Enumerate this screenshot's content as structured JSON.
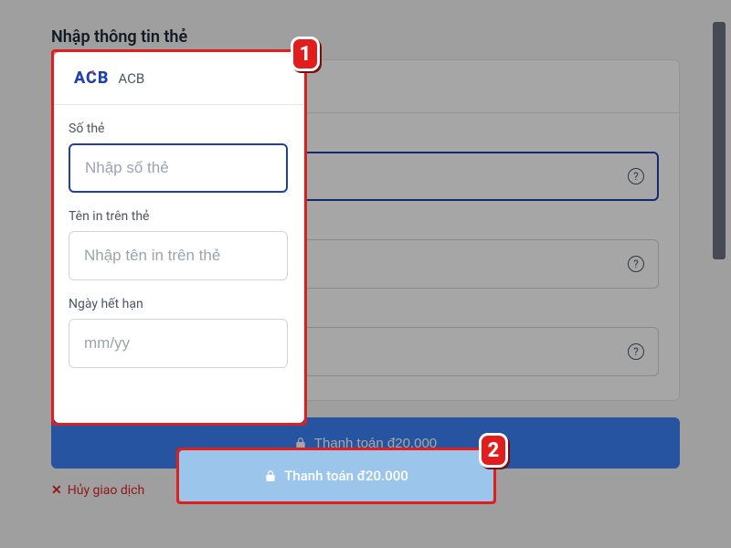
{
  "title": "Nhập thông tin thẻ",
  "bank": {
    "logo": "ACB",
    "name": "ACB"
  },
  "fields": {
    "card_number": {
      "label": "Số thẻ",
      "placeholder": "Nhập số thẻ"
    },
    "card_name": {
      "label": "Tên in trên thẻ",
      "placeholder": "Nhập tên in trên thẻ"
    },
    "expiry": {
      "label": "Ngày hết hạn",
      "placeholder": "mm/yy"
    }
  },
  "pay_button": "Thanh toán đ20.000",
  "cancel": "Hủy giao dịch",
  "callouts": {
    "one": "1",
    "two": "2"
  }
}
